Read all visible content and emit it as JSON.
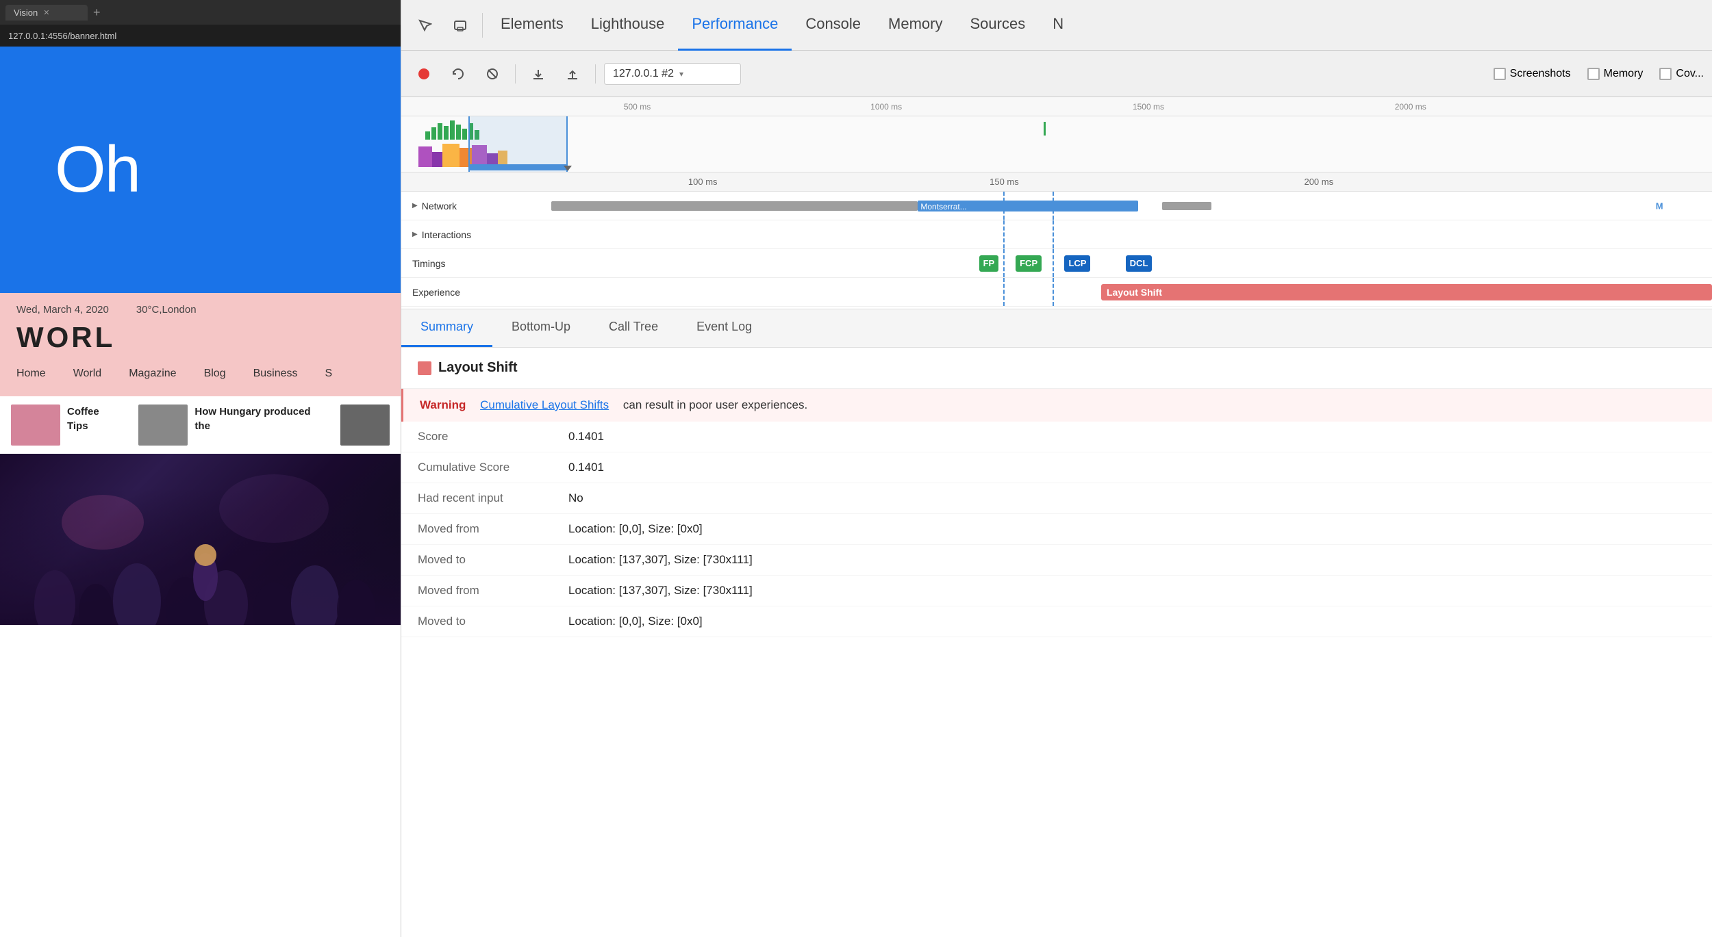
{
  "browser": {
    "tab_title": "Vision",
    "address": "127.0.0.1:4556/banner.html",
    "new_tab_label": "+"
  },
  "webpage": {
    "banner_text": "Oh",
    "date": "Wed, March 4, 2020",
    "location": "30°C,London",
    "site_title": "WORL",
    "nav_items": [
      "Home",
      "World",
      "Magazine",
      "Blog",
      "Business",
      "S"
    ],
    "card1_title": "Coffee Tips",
    "card2_title": "How Hungary produced the",
    "concert_alt": "concert crowd"
  },
  "devtools": {
    "tabs": [
      {
        "id": "elements",
        "label": "Elements"
      },
      {
        "id": "lighthouse",
        "label": "Lighthouse"
      },
      {
        "id": "performance",
        "label": "Performance"
      },
      {
        "id": "console",
        "label": "Console"
      },
      {
        "id": "memory",
        "label": "Memory"
      },
      {
        "id": "sources",
        "label": "Sources"
      },
      {
        "id": "more",
        "label": "N"
      }
    ],
    "toolbar": {
      "target_selector": "127.0.0.1 #2",
      "checkbox_screenshots": "Screenshots",
      "checkbox_memory": "Memory",
      "checkbox_coverage": "Cov..."
    },
    "timeline": {
      "ruler_marks": [
        "500 ms",
        "1000 ms",
        "1500 ms",
        "2000 ms"
      ],
      "ruler_positions": [
        18,
        37,
        57,
        77
      ],
      "time_marks": [
        "100 ms",
        "150 ms",
        "200 ms"
      ],
      "time_positions": [
        23,
        46,
        70
      ]
    },
    "rows": {
      "network_label": "Network",
      "interactions_label": "Interactions",
      "timings_label": "Timings",
      "experience_label": "Experience"
    },
    "timings": {
      "fp": {
        "label": "FP",
        "color": "#34a853"
      },
      "fcp": {
        "label": "FCP",
        "color": "#34a853"
      },
      "lcp": {
        "label": "LCP",
        "color": "#1565c0"
      },
      "dcl": {
        "label": "DCL",
        "color": "#1565c0"
      }
    },
    "network_bars": {
      "montserrat_label": "Montserrat...",
      "m_label": "M"
    },
    "layout_shift": {
      "label": "Layout Shift",
      "bar_color": "#e57373"
    },
    "bottom_tabs": [
      "Summary",
      "Bottom-Up",
      "Call Tree",
      "Event Log"
    ],
    "active_bottom_tab": "Summary",
    "detail": {
      "header": "Layout Shift",
      "warning_prefix": "Warning",
      "warning_link": "Cumulative Layout Shifts",
      "warning_suffix": "can result in poor user experiences.",
      "score_label": "Score",
      "score_value": "0.1401",
      "cumulative_score_label": "Cumulative Score",
      "cumulative_score_value": "0.1401",
      "had_recent_input_label": "Had recent input",
      "had_recent_input_value": "No",
      "moved_from_1_label": "Moved from",
      "moved_from_1_value": "Location: [0,0], Size: [0x0]",
      "moved_to_1_label": "Moved to",
      "moved_to_1_value": "Location: [137,307], Size: [730x111]",
      "moved_from_2_label": "Moved from",
      "moved_from_2_value": "Location: [137,307], Size: [730x111]",
      "moved_to_2_label": "Moved to",
      "moved_to_2_value": "Location: [0,0], Size: [0x0]"
    }
  }
}
